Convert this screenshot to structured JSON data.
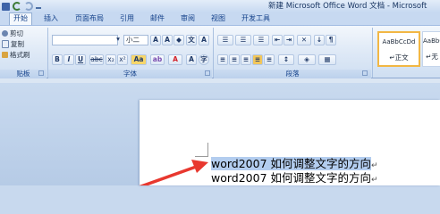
{
  "window": {
    "title": "新建 Microsoft Office Word 文档 - Microsoft"
  },
  "tabs": [
    {
      "label": "开始",
      "active": true
    },
    {
      "label": "插入"
    },
    {
      "label": "页面布局"
    },
    {
      "label": "引用"
    },
    {
      "label": "邮件"
    },
    {
      "label": "审阅"
    },
    {
      "label": "视图"
    },
    {
      "label": "开发工具"
    }
  ],
  "clipboard": {
    "cut_label": "剪切",
    "copy_label": "复制",
    "format_painter_label": "格式刷",
    "group_label": "贴板"
  },
  "font": {
    "name_value": "",
    "size_value": "小二",
    "group_label": "字体"
  },
  "paragraph": {
    "group_label": "段落"
  },
  "styles": [
    {
      "sample": "AaBbCcDd",
      "name": "正文",
      "selected": true
    },
    {
      "sample": "AaBbC",
      "name": "无"
    }
  ],
  "document": {
    "lines": [
      {
        "text": "word2007 如何调整文字的方向",
        "mark": "↵",
        "highlighted": true
      },
      {
        "text": "word2007 如何调整文字的方向",
        "mark": "↵",
        "highlighted": false
      }
    ]
  },
  "colors": {
    "highlight": "#b3cdef",
    "arrow": "#e8382f",
    "ribbon": "#dde8f6",
    "tab_text": "#15428b"
  }
}
